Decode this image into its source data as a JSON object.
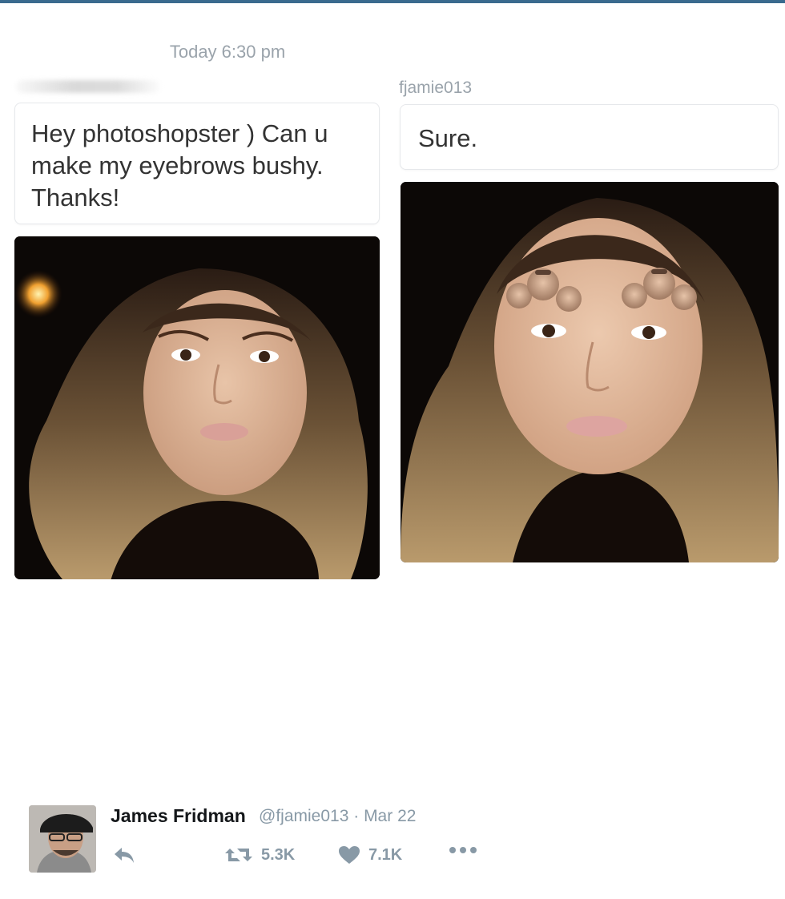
{
  "conversation": {
    "timestamp": "Today 6:30 pm",
    "left_message": {
      "text": "Hey photoshopster ) Can u make my eyebrows bushy. Thanks!"
    },
    "right_message": {
      "sender": "fjamie013",
      "text": "Sure."
    }
  },
  "tweet": {
    "author_name": "James Fridman",
    "author_handle": "@fjamie013",
    "separator": "·",
    "date": "Mar 22",
    "retweet_count": "5.3K",
    "like_count": "7.1K",
    "icons": [
      "reply-icon",
      "retweet-icon",
      "heart-icon",
      "more-icon"
    ]
  },
  "colors": {
    "top_bar": "#3a6a8e",
    "meta_text": "#9aa3ab",
    "action_gray": "#8899a6",
    "bubble_border": "#e6e8eb"
  }
}
